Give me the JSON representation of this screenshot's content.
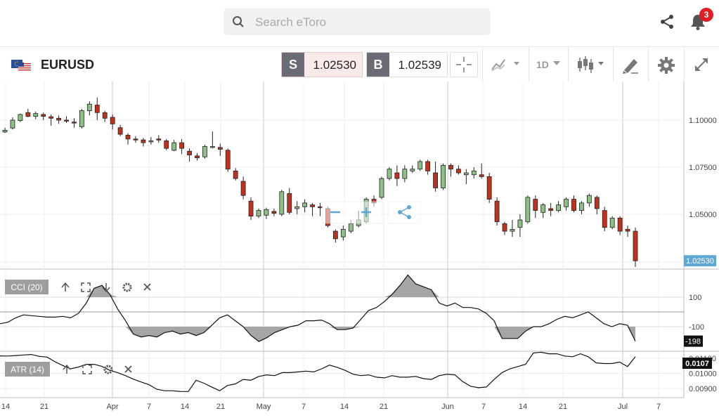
{
  "search": {
    "placeholder": "Search eToro"
  },
  "notifications": {
    "count": "3"
  },
  "instrument": {
    "symbol": "EURUSD"
  },
  "trade": {
    "sell_tag": "S",
    "sell_price": "1.02530",
    "buy_tag": "B",
    "buy_price": "1.02539"
  },
  "toolbar": {
    "timeframe": "1D"
  },
  "colors": {
    "up": "#8cc084",
    "down": "#c0321e",
    "price_tag": "#5fa8d3",
    "badge": "#e01f25"
  },
  "chart_data": [
    {
      "type": "candlestick",
      "x_ticks": [
        "14",
        "21",
        "Apr",
        "7",
        "14",
        "21",
        "May",
        "7",
        "14",
        "21",
        "Jun",
        "7",
        "14",
        "21",
        "Jul",
        "7"
      ],
      "y_ticks": [
        "1.10000",
        "1.07500",
        "1.05000"
      ],
      "last_price_label": "1.02530",
      "candles": [
        [
          1.0937,
          1.096,
          1.0932,
          1.0946
        ],
        [
          1.0958,
          1.1015,
          1.095,
          1.1
        ],
        [
          1.0998,
          1.1035,
          1.099,
          1.103
        ],
        [
          1.104,
          1.106,
          1.1015,
          1.102
        ],
        [
          1.102,
          1.1045,
          1.1005,
          1.1035
        ],
        [
          1.103,
          1.104,
          1.1,
          1.102
        ],
        [
          1.1018,
          1.103,
          1.097,
          1.101
        ],
        [
          1.101,
          1.1025,
          1.098,
          1.1
        ],
        [
          1.1,
          1.102,
          1.0985,
          1.0995
        ],
        [
          1.099,
          1.101,
          1.096,
          1.0985
        ],
        [
          1.0965,
          1.106,
          1.0955,
          1.105
        ],
        [
          1.105,
          1.11,
          1.1025,
          1.1085
        ],
        [
          1.108,
          1.112,
          1.1,
          1.104
        ],
        [
          1.104,
          1.105,
          1.099,
          1.101
        ],
        [
          1.1015,
          1.103,
          1.095,
          1.098
        ],
        [
          1.096,
          1.0975,
          1.0915,
          1.0925
        ],
        [
          1.092,
          1.093,
          1.087,
          1.09
        ],
        [
          1.09,
          1.0915,
          1.088,
          1.0895
        ],
        [
          1.0895,
          1.0905,
          1.086,
          1.088
        ],
        [
          1.089,
          1.091,
          1.087,
          1.089
        ],
        [
          1.09,
          1.092,
          1.088,
          1.0895
        ],
        [
          1.089,
          1.09,
          1.084,
          1.085
        ],
        [
          1.084,
          1.0895,
          1.0835,
          1.088
        ],
        [
          1.088,
          1.09,
          1.082,
          1.085
        ],
        [
          1.0835,
          1.085,
          1.078,
          1.0815
        ],
        [
          1.081,
          1.0825,
          1.0785,
          1.08
        ],
        [
          1.0805,
          1.087,
          1.0795,
          1.086
        ],
        [
          1.086,
          1.094,
          1.085,
          1.086
        ],
        [
          1.0855,
          1.0875,
          1.081,
          1.0845
        ],
        [
          1.084,
          1.085,
          1.0725,
          1.074
        ],
        [
          1.073,
          1.0745,
          1.068,
          1.069
        ],
        [
          1.0675,
          1.07,
          1.058,
          1.06
        ],
        [
          1.057,
          1.059,
          1.047,
          1.049
        ],
        [
          1.049,
          1.053,
          1.048,
          1.052
        ],
        [
          1.0495,
          1.0535,
          1.0475,
          1.0525
        ],
        [
          1.0515,
          1.053,
          1.049,
          1.0505
        ],
        [
          1.05,
          1.063,
          1.049,
          1.062
        ],
        [
          1.061,
          1.064,
          1.05,
          1.051
        ],
        [
          1.053,
          1.057,
          1.05,
          1.054
        ],
        [
          1.054,
          1.058,
          1.051,
          1.056
        ],
        [
          1.055,
          1.056,
          1.049,
          1.054
        ],
        [
          1.054,
          1.056,
          1.049,
          1.0535
        ],
        [
          1.053,
          1.054,
          1.043,
          1.044
        ],
        [
          1.041,
          1.042,
          1.035,
          1.037
        ],
        [
          1.038,
          1.044,
          1.036,
          1.042
        ],
        [
          1.041,
          1.047,
          1.04,
          1.045
        ],
        [
          1.044,
          1.052,
          1.043,
          1.047
        ],
        [
          1.046,
          1.059,
          1.045,
          1.058
        ],
        [
          1.058,
          1.06,
          1.054,
          1.056
        ],
        [
          1.059,
          1.07,
          1.058,
          1.069
        ],
        [
          1.069,
          1.075,
          1.068,
          1.074
        ],
        [
          1.072,
          1.076,
          1.065,
          1.069
        ],
        [
          1.069,
          1.076,
          1.067,
          1.074
        ],
        [
          1.073,
          1.076,
          1.072,
          1.074
        ],
        [
          1.074,
          1.079,
          1.073,
          1.078
        ],
        [
          1.078,
          1.079,
          1.071,
          1.073
        ],
        [
          1.072,
          1.078,
          1.062,
          1.064
        ],
        [
          1.064,
          1.077,
          1.063,
          1.076
        ],
        [
          1.076,
          1.077,
          1.07,
          1.074
        ],
        [
          1.074,
          1.076,
          1.071,
          1.072
        ],
        [
          1.071,
          1.074,
          1.066,
          1.072
        ],
        [
          1.071,
          1.075,
          1.069,
          1.073
        ],
        [
          1.071,
          1.077,
          1.069,
          1.07
        ],
        [
          1.07,
          1.072,
          1.056,
          1.058
        ],
        [
          1.057,
          1.059,
          1.044,
          1.046
        ],
        [
          1.045,
          1.046,
          1.039,
          1.041
        ],
        [
          1.041,
          1.047,
          1.038,
          1.042
        ],
        [
          1.043,
          1.05,
          1.038,
          1.047
        ],
        [
          1.046,
          1.06,
          1.045,
          1.059
        ],
        [
          1.058,
          1.06,
          1.048,
          1.052
        ],
        [
          1.051,
          1.056,
          1.048,
          1.055
        ],
        [
          1.053,
          1.056,
          1.049,
          1.052
        ],
        [
          1.052,
          1.057,
          1.051,
          1.055
        ],
        [
          1.054,
          1.059,
          1.052,
          1.058
        ],
        [
          1.058,
          1.06,
          1.051,
          1.052
        ],
        [
          1.052,
          1.057,
          1.05,
          1.056
        ],
        [
          1.056,
          1.061,
          1.054,
          1.06
        ],
        [
          1.059,
          1.06,
          1.05,
          1.053
        ],
        [
          1.052,
          1.054,
          1.041,
          1.043
        ],
        [
          1.043,
          1.049,
          1.042,
          1.048
        ],
        [
          1.048,
          1.049,
          1.039,
          1.041
        ],
        [
          1.042,
          1.044,
          1.038,
          1.041
        ],
        [
          1.041,
          1.043,
          1.022,
          1.0253
        ]
      ]
    },
    {
      "type": "line",
      "name": "CCI (20)",
      "y_ticks": [
        "100",
        "-100"
      ],
      "last_value_label": "-198",
      "values": [
        -80,
        -70,
        -40,
        -20,
        -25,
        -30,
        -35,
        -35,
        -30,
        -40,
        -10,
        60,
        160,
        180,
        120,
        20,
        -60,
        -150,
        -170,
        -160,
        -170,
        -140,
        -130,
        -150,
        -140,
        -160,
        -140,
        -90,
        -40,
        -20,
        -60,
        -100,
        -160,
        -200,
        -175,
        -140,
        -120,
        -100,
        -90,
        -60,
        -60,
        -55,
        -80,
        -120,
        -120,
        -110,
        -50,
        10,
        30,
        70,
        120,
        180,
        250,
        190,
        170,
        150,
        60,
        40,
        60,
        30,
        30,
        20,
        -10,
        -60,
        -180,
        -180,
        -180,
        -130,
        -100,
        -100,
        -80,
        -50,
        -30,
        -40,
        -20,
        0,
        -40,
        -80,
        -100,
        -80,
        -90,
        -198
      ]
    },
    {
      "type": "line",
      "name": "ATR (14)",
      "y_ticks": [
        "0.01100",
        "0.01000",
        "0.00900"
      ],
      "last_value_label": "0.0107",
      "values": [
        0.01116,
        0.01115,
        0.01118,
        0.01122,
        0.01125,
        0.01113,
        0.01108,
        0.01077,
        0.01052,
        0.0103,
        0.01042,
        0.0106,
        0.0106,
        0.01046,
        0.0102,
        0.01005,
        0.00985,
        0.00962,
        0.00943,
        0.00925,
        0.00895,
        0.00885,
        0.00885,
        0.0088,
        0.0088,
        0.00955,
        0.00935,
        0.0091,
        0.00885,
        0.0092,
        0.0093,
        0.0096,
        0.00955,
        0.0098,
        0.0099,
        0.00985,
        0.01005,
        0.01005,
        0.0101,
        0.01015,
        0.0101,
        0.0103,
        0.01055,
        0.0104,
        0.0102,
        0.00995,
        0.00985,
        0.0099,
        0.00975,
        0.0097,
        0.00985,
        0.00975,
        0.00975,
        0.0098,
        0.00965,
        0.0096,
        0.00985,
        0.00995,
        0.0099,
        0.00945,
        0.00915,
        0.00905,
        0.0091,
        0.0096,
        0.01005,
        0.0103,
        0.01045,
        0.0106,
        0.01135,
        0.0114,
        0.0113,
        0.0113,
        0.01115,
        0.0111,
        0.0113,
        0.0111,
        0.0107,
        0.01065,
        0.01065,
        0.01075,
        0.01045,
        0.0111
      ]
    }
  ]
}
